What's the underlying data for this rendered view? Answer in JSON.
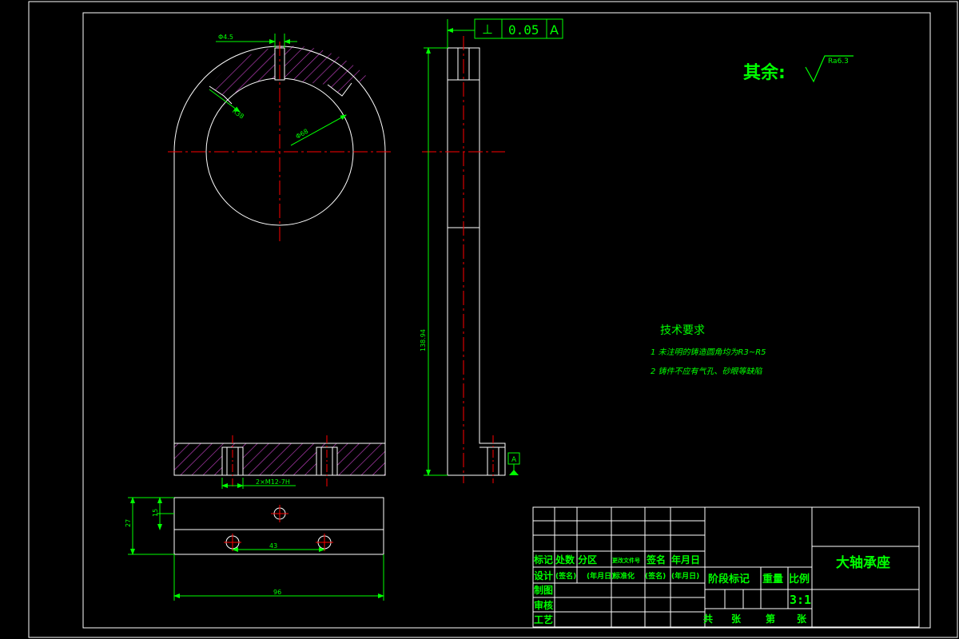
{
  "colors": {
    "background": "#000000",
    "outline": "#ffffff",
    "centerline": "#ff0000",
    "dimension": "#00ff00",
    "hatch": "#cc44cc",
    "annotation": "#00ff00"
  },
  "tolerance_frame": {
    "symbol": "⊥",
    "value": "0.05",
    "datum": "A"
  },
  "surface_finish": {
    "label": "其余:",
    "roughness": "Ra6.3"
  },
  "dimensions": {
    "top_slot_width": "Φ4.5",
    "arc_radius": "R38",
    "bore_diameter": "Φ68",
    "height": "138.94",
    "holes": "2×M12-7H",
    "base_thickness": "27",
    "hole_offset": "15",
    "hole_spacing": "43",
    "total_width": "96"
  },
  "datum_label": "A",
  "tech_notes": {
    "title": "技术要求",
    "items": [
      "1 未注明的铸造圆角均为R3~R5",
      "2 铸件不应有气孔、砂眼等缺陷"
    ]
  },
  "title_block": {
    "part_name": "大轴承座",
    "scale_label": "比例",
    "scale": "3:1",
    "stage_label": "阶段标记",
    "weight_label": "重量",
    "header_row": [
      "标记",
      "处数",
      "分区",
      "更改文件号",
      "签名",
      "年月日"
    ],
    "design_row": [
      "设计",
      "(签名)",
      "(年月日)",
      "标准化",
      "(签名)",
      "(年月日)"
    ],
    "roles": [
      "制图",
      "审核",
      "工艺"
    ],
    "sheet_info": [
      "共",
      "张",
      "第",
      "张"
    ]
  }
}
